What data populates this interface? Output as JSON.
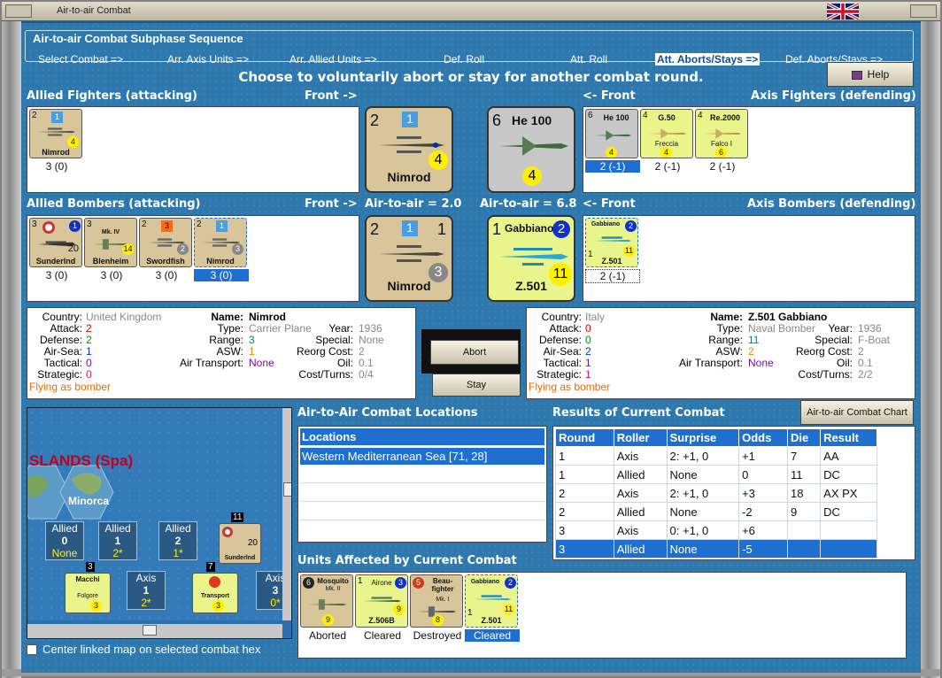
{
  "window": {
    "title": "Air-to-air Combat"
  },
  "phase": {
    "title": "Air-to-air Combat Subphase Sequence",
    "steps": [
      "Select Combat =>",
      "Arr. Axis Units =>",
      "Arr. Allied Units =>",
      "Def. Roll",
      "Att. Roll",
      "Att. Aborts/Stays =>",
      "Def. Aborts/Stays =>"
    ],
    "active_index": 5
  },
  "instruction": "Choose to voluntarily abort or stay for another combat round.",
  "help_button": "Help",
  "labels": {
    "allied_fighters": "Allied Fighters (attacking)",
    "front_right": "Front ->",
    "front_left": "<- Front",
    "axis_fighters": "Axis Fighters (defending)",
    "allied_bombers": "Allied Bombers (attacking)",
    "axis_bombers": "Axis Bombers (defending)",
    "air_allied": "Air-to-air = 2.0",
    "air_axis": "Air-to-air = 6.8"
  },
  "allied_fighters": [
    {
      "name": "Nimrod",
      "tl": "2",
      "tr": "1",
      "val": "4",
      "cap": "3 (0)"
    }
  ],
  "axis_fighters": [
    {
      "name": "He 100",
      "tl": "6",
      "val": "4",
      "cap": "2 (-1)",
      "selected": true
    },
    {
      "name": "G.50",
      "sub": "Freccia",
      "tl": "4",
      "val": "4",
      "cap": "2 (-1)"
    },
    {
      "name": "Re.2000",
      "sub": "Falco I",
      "tl": "4",
      "val": "6",
      "cap": "2 (-1)"
    }
  ],
  "allied_bombers": [
    {
      "name": "Sunderlnd",
      "tl": "3",
      "tr": "1",
      "val": "20",
      "cap": "3 (0)"
    },
    {
      "name": "Blenheim",
      "sub": "Mk. IV",
      "tl": "3",
      "val": "14",
      "cap": "3 (0)"
    },
    {
      "name": "Swordfish",
      "tl": "2",
      "tr": "3",
      "val": "2",
      "cap": "3 (0)"
    },
    {
      "name": "Nimrod",
      "tl": "2",
      "tr": "1",
      "val": "3",
      "cap": "3 (0)",
      "selected": true
    }
  ],
  "axis_bombers": [
    {
      "name": "Z.501",
      "sub": "Gabbiano",
      "tl": "1",
      "tr": "2",
      "val": "11",
      "cap": "2 (-1)"
    }
  ],
  "big_counters": {
    "allied_fighter": {
      "name": "Nimrod",
      "tl": "2",
      "tr": "1",
      "val": "4"
    },
    "axis_fighter": {
      "name": "He 100",
      "tl": "6",
      "val": "4"
    },
    "allied_bomber": {
      "name": "Nimrod",
      "tl": "2",
      "tr": "1",
      "val": "3",
      "br": "1"
    },
    "axis_bomber": {
      "name": "Z.501",
      "sub": "Gabbiano",
      "tl": "1",
      "tr": "2",
      "val": "11"
    }
  },
  "allied_info": {
    "country_l": "Country:",
    "country": "United Kingdom",
    "attack_l": "Attack:",
    "attack": "2",
    "defense_l": "Defense:",
    "defense": "2",
    "airsea_l": "Air-Sea:",
    "airsea": "1",
    "tactical_l": "Tactical:",
    "tactical": "0",
    "strategic_l": "Strategic:",
    "strategic": "0",
    "flying": "Flying as bomber",
    "name_l": "Name:",
    "name": "Nimrod",
    "type_l": "Type:",
    "type": "Carrier Plane",
    "range_l": "Range:",
    "range": "3",
    "asw_l": "ASW:",
    "asw": "1",
    "airtrans_l": "Air Transport:",
    "airtrans": "None",
    "year_l": "Year:",
    "year": "1936",
    "special_l": "Special:",
    "special": "None",
    "reorg_l": "Reorg Cost:",
    "reorg": "2",
    "oil_l": "Oil:",
    "oil": "0.1",
    "cost_l": "Cost/Turns:",
    "cost": "0/4"
  },
  "axis_info": {
    "country_l": "Country:",
    "country": "Italy",
    "attack_l": "Attack:",
    "attack": "0",
    "defense_l": "Defense:",
    "defense": "0",
    "airsea_l": "Air-Sea:",
    "airsea": "2",
    "tactical_l": "Tactical:",
    "tactical": "1",
    "strategic_l": "Strategic:",
    "strategic": "1",
    "flying": "Flying as bomber",
    "name_l": "Name:",
    "name": "Z.501 Gabbiano",
    "type_l": "Type:",
    "type": "Naval Bomber",
    "range_l": "Range:",
    "range": "11",
    "asw_l": "ASW:",
    "asw": "2",
    "airtrans_l": "Air Transport:",
    "airtrans": "None",
    "year_l": "Year:",
    "year": "1936",
    "special_l": "Special:",
    "special": "F-Boat",
    "reorg_l": "Reorg Cost:",
    "reorg": "2",
    "oil_l": "Oil:",
    "oil": "0.1",
    "cost_l": "Cost/Turns:",
    "cost": "2/2"
  },
  "buttons": {
    "abort": "Abort",
    "stay": "Stay",
    "chart": "Air-to-air Combat Chart"
  },
  "map": {
    "region": "SLANDS (Spa)",
    "island": "Minorca",
    "boxes": [
      {
        "side": "Allied",
        "num": "0",
        "sub": "None"
      },
      {
        "side": "Allied",
        "num": "1",
        "sub": "2*"
      },
      {
        "side": "Allied",
        "num": "2",
        "sub": "1*"
      },
      {
        "side": "Axis",
        "num": "1",
        "sub": "2*"
      },
      {
        "side": "Axis",
        "num": "3",
        "sub": "0*"
      }
    ],
    "stacks": [
      {
        "count": "11",
        "name": "Sunderlnd",
        "val": "20"
      },
      {
        "count": "3",
        "name": "Macchi",
        "sub": "Folgore",
        "val": "3"
      },
      {
        "count": "7",
        "name": "Transport",
        "val": "3"
      }
    ],
    "center_checkbox": "Center linked map on selected combat hex"
  },
  "locations": {
    "title": "Air-to-Air Combat Locations",
    "header": "Locations",
    "items": [
      "Western Mediterranean Sea [71, 28]"
    ]
  },
  "results": {
    "title": "Results of Current Combat",
    "headers": [
      "Round",
      "Roller",
      "Surprise",
      "Odds",
      "Die",
      "Result"
    ],
    "rows": [
      [
        "1",
        "Axis",
        "2: +1, 0",
        "+1",
        "7",
        "AA"
      ],
      [
        "1",
        "Allied",
        "None",
        "0",
        "11",
        "DC"
      ],
      [
        "2",
        "Axis",
        "2: +1, 0",
        "+3",
        "18",
        "AX PX"
      ],
      [
        "2",
        "Allied",
        "None",
        "-2",
        "9",
        "DC"
      ],
      [
        "3",
        "Axis",
        "0: +1, 0",
        "+6",
        "",
        ""
      ],
      [
        "3",
        "Allied",
        "None",
        "-5",
        "",
        ""
      ]
    ],
    "selected_row": 5
  },
  "affected": {
    "title": "Units Affected by Current Combat",
    "units": [
      {
        "name": "Mosquito",
        "sub": "Mk. II",
        "tl": "6",
        "val": "9",
        "status": "Aborted"
      },
      {
        "name": "Z.506B",
        "sub": "Airone",
        "tl": "1",
        "tr": "3",
        "val": "9",
        "status": "Cleared"
      },
      {
        "name": "Beau-fighter",
        "sub": "Mk. I",
        "tl": "5",
        "val": "8",
        "status": "Destroyed"
      },
      {
        "name": "Z.501",
        "sub": "Gabbiano",
        "tl": "1",
        "tr": "2",
        "val": "11",
        "status": "Cleared",
        "selected": true
      }
    ]
  }
}
